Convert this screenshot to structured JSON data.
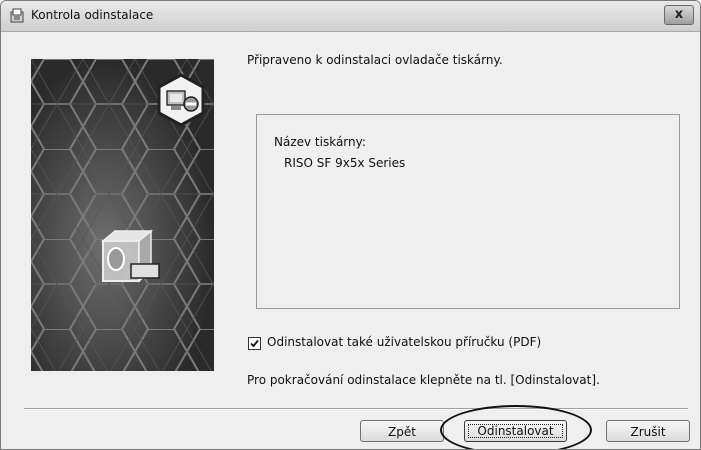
{
  "window": {
    "title": "Kontrola odinstalace",
    "close_label": "x"
  },
  "main": {
    "heading": "Připraveno k odinstalaci ovladače tiskárny.",
    "printer_label": "Název tiskárny:",
    "printer_name": "RISO SF 9x5x Series",
    "checkbox_label": "Odinstalovat také uživatelskou příručku (PDF)",
    "checkbox_checked": true,
    "instruction": "Pro pokračování odinstalace klepněte na tl. [Odinstalovat]."
  },
  "buttons": {
    "back": "Zpět",
    "uninstall": "Odinstalovat",
    "cancel": "Zrušit"
  },
  "icons": [
    "installer-icon",
    "uninstall-computer-icon",
    "printer-icon",
    "checkmark-icon"
  ]
}
